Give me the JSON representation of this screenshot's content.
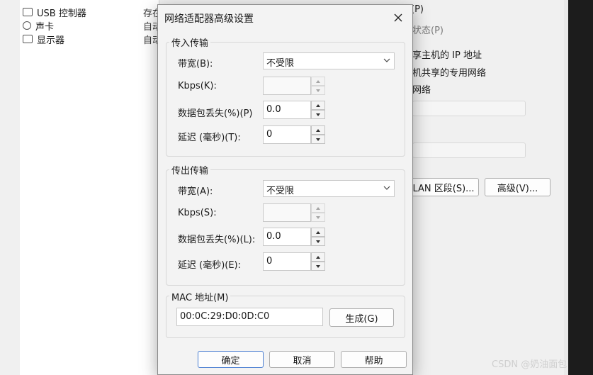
{
  "background": {
    "devices": [
      {
        "label": "USB 控制器",
        "status": "存在"
      },
      {
        "label": "声卡",
        "status": "自动"
      },
      {
        "label": "显示器",
        "status": "自动"
      }
    ],
    "right_options": [
      "(P)",
      "状态(P)",
      "享主机的 IP 地址",
      "机共享的专用网络",
      "网络"
    ],
    "lan_segment_button": "LAN 区段(S)...",
    "advanced_button": "高级(V)..."
  },
  "dialog": {
    "title": "网络适配器高级设置",
    "incoming": {
      "legend": "传入传输",
      "bandwidth_label": "带宽(B):",
      "bandwidth_value": "不受限",
      "kbps_label": "Kbps(K):",
      "kbps_value": "",
      "loss_label": "数据包丢失(%)(P)",
      "loss_value": "0.0",
      "latency_label": "延迟 (毫秒)(T):",
      "latency_value": "0"
    },
    "outgoing": {
      "legend": "传出传输",
      "bandwidth_label": "带宽(A):",
      "bandwidth_value": "不受限",
      "kbps_label": "Kbps(S):",
      "kbps_value": "",
      "loss_label": "数据包丢失(%)(L):",
      "loss_value": "0.0",
      "latency_label": "延迟 (毫秒)(E):",
      "latency_value": "0"
    },
    "mac": {
      "legend": "MAC 地址(M)",
      "value": "00:0C:29:D0:0D:C0",
      "generate_button": "生成(G)"
    },
    "ok_button": "确定",
    "cancel_button": "取消",
    "help_button": "帮助"
  },
  "watermark": "CSDN @奶油面包",
  "icons": {
    "close": "close-icon",
    "dropdown": "chevron-down-icon",
    "spin_up": "caret-up-icon",
    "spin_down": "caret-down-icon"
  },
  "colors": {
    "accent": "#4a7ed1",
    "dialog_bg": "#f3f3f3"
  }
}
